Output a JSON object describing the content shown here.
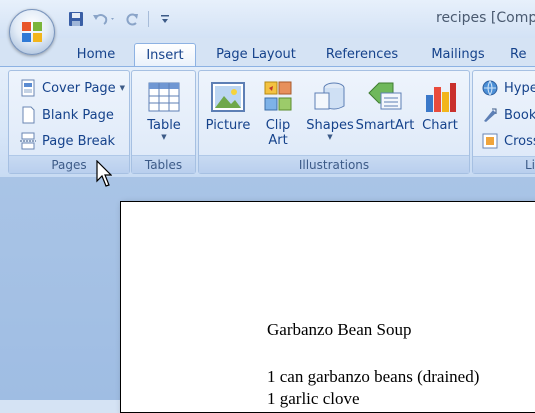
{
  "window": {
    "title": "recipes [Comp"
  },
  "tabs": [
    {
      "label": "Home",
      "active": false
    },
    {
      "label": "Insert",
      "active": true
    },
    {
      "label": "Page Layout",
      "active": false
    },
    {
      "label": "References",
      "active": false
    },
    {
      "label": "Mailings",
      "active": false
    },
    {
      "label": "Re",
      "active": false
    }
  ],
  "groups": {
    "pages": {
      "label": "Pages",
      "items": [
        {
          "label": "Cover Page",
          "icon": "cover-page-icon",
          "has_dropdown": true
        },
        {
          "label": "Blank Page",
          "icon": "blank-page-icon"
        },
        {
          "label": "Page Break",
          "icon": "page-break-icon"
        }
      ]
    },
    "tables": {
      "label": "Tables",
      "table_label": "Table"
    },
    "illustrations": {
      "label": "Illustrations",
      "picture": "Picture",
      "clipart_line1": "Clip",
      "clipart_line2": "Art",
      "shapes": "Shapes",
      "smartart": "SmartArt",
      "chart": "Chart"
    },
    "links": {
      "label": "Li",
      "items": [
        {
          "label": "Hype",
          "icon": "hyperlink-icon"
        },
        {
          "label": "Book",
          "icon": "bookmark-icon"
        },
        {
          "label": "Cross",
          "icon": "cross-reference-icon"
        }
      ]
    }
  },
  "document": {
    "lines": [
      "Garbanzo Bean Soup",
      "1 can garbanzo beans (drained)",
      "1 garlic clove"
    ]
  },
  "colors": {
    "accent": "#15428b",
    "ribbon": "#dce8f8",
    "workspace": "#a9c4e6"
  }
}
